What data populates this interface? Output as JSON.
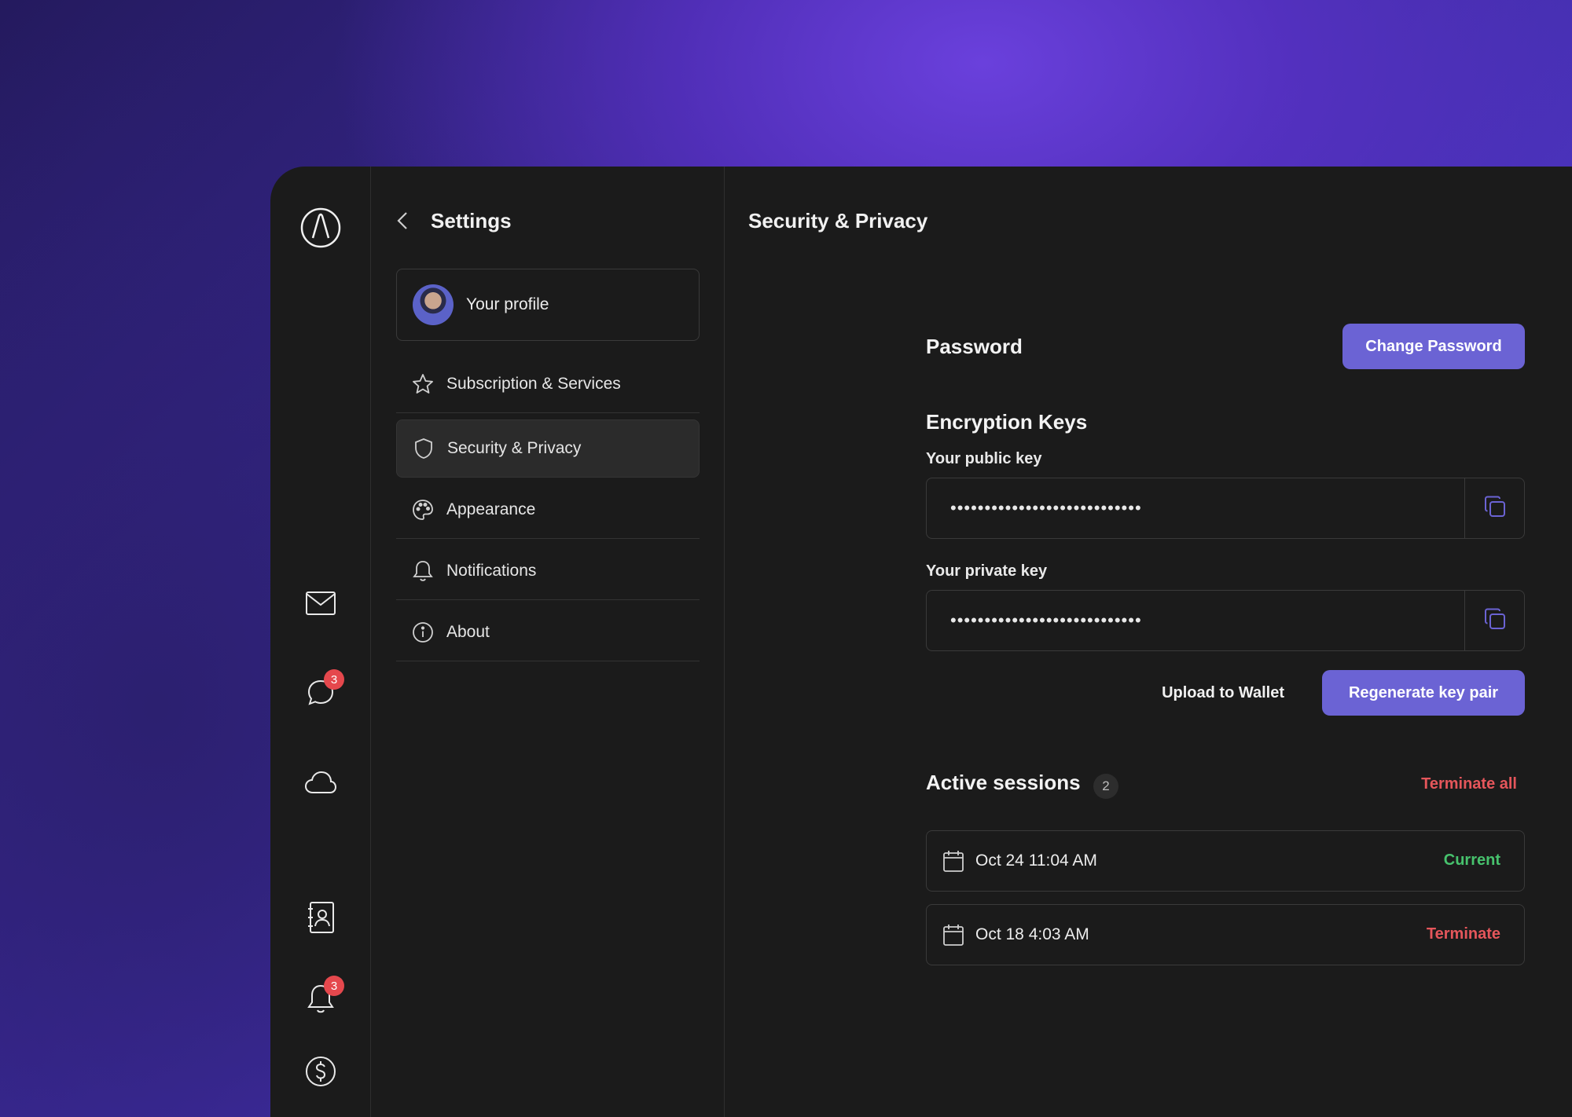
{
  "nav": {
    "title": "Settings",
    "profile_label": "Your profile",
    "items": [
      {
        "label": "Subscription & Services",
        "icon": "star-icon"
      },
      {
        "label": "Security & Privacy",
        "icon": "shield-icon",
        "active": true
      },
      {
        "label": "Appearance",
        "icon": "palette-icon"
      },
      {
        "label": "Notifications",
        "icon": "bell-icon"
      },
      {
        "label": "About",
        "icon": "info-icon"
      }
    ]
  },
  "rail": {
    "chat_badge": "3",
    "bell_badge": "3"
  },
  "main": {
    "title": "Security & Privacy",
    "password": {
      "heading": "Password",
      "change_button": "Change Password"
    },
    "encryption": {
      "heading": "Encryption Keys",
      "public_label": "Your public key",
      "public_value": "••••••••••••••••••••••••••••",
      "private_label": "Your private key",
      "private_value": "••••••••••••••••••••••••••••",
      "upload_button": "Upload to Wallet",
      "regenerate_button": "Regenerate key pair"
    },
    "sessions": {
      "heading": "Active sessions",
      "count": "2",
      "terminate_all": "Terminate all",
      "items": [
        {
          "date": "Oct 24 11:04 AM",
          "status": "Current"
        },
        {
          "date": "Oct 18 4:03 AM",
          "status": "Terminate"
        }
      ]
    }
  },
  "colors": {
    "accent": "#6b63d4",
    "danger": "#e5565b",
    "success": "#47c26d",
    "badge": "#e5484d"
  }
}
